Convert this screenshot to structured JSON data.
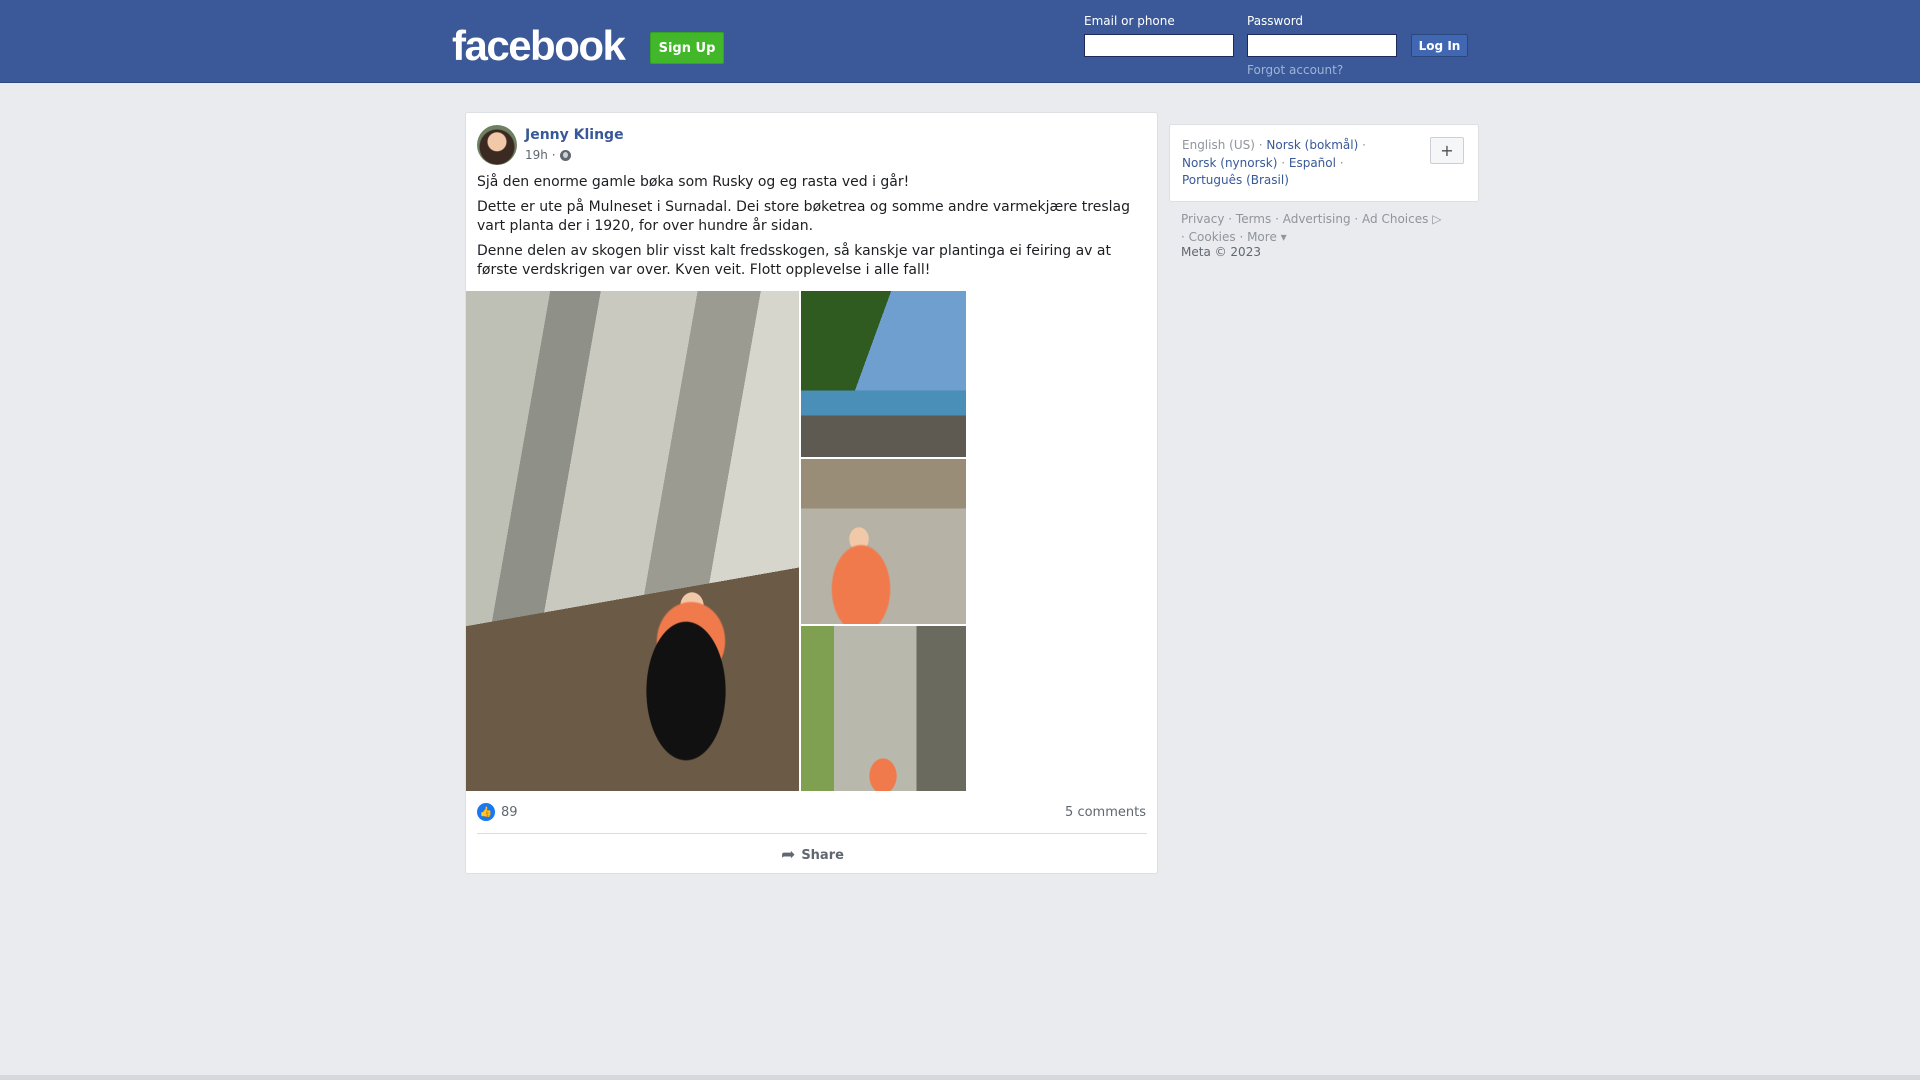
{
  "header": {
    "logo": "facebook",
    "signup_label": "Sign Up",
    "email_label": "Email or phone",
    "email_value": "",
    "password_label": "Password",
    "password_value": "",
    "login_label": "Log In",
    "forgot_label": "Forgot account?"
  },
  "post": {
    "author": "Jenny Klinge",
    "time": "19h ·",
    "paragraphs": [
      "Sjå den enorme gamle bøka som Rusky og eg rasta ved i går!",
      "Dette er ute på Mulneset i Surnadal. Dei store bøketrea og somme andre varmekjære treslag vart planta der i 1920, for over hundre år sidan.",
      "Denne delen av skogen blir visst kalt fredsskogen, så kanskje var plantinga ei feiring av at første verdskrigen var over. Kven veit. Flott opplevelse i alle fall!"
    ],
    "likes": "89",
    "comments": "5 comments",
    "share_label": "Share"
  },
  "sidebar": {
    "languages": [
      {
        "label": "English (US)",
        "active": true
      },
      {
        "label": "Norsk (bokmål)"
      },
      {
        "label": "Norsk (nynorsk)"
      },
      {
        "label": "Español"
      },
      {
        "label": "Português (Brasil)"
      }
    ],
    "plus_label": "+",
    "footer": [
      "Privacy",
      "Terms",
      "Advertising",
      "Ad Choices",
      "Cookies",
      "More"
    ],
    "copyright": "Meta © 2023"
  },
  "colors": {
    "brand": "#3b5998",
    "signup": "#42b72a",
    "link": "#385898",
    "like": "#1877f2"
  }
}
